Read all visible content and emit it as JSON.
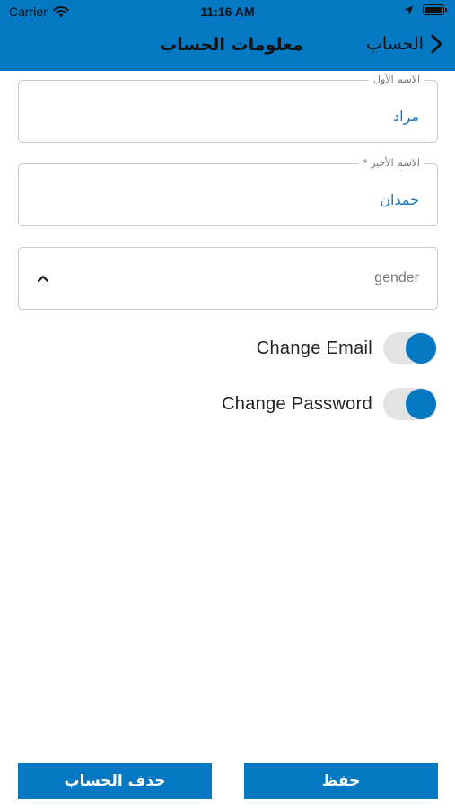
{
  "status_bar": {
    "carrier": "Carrier",
    "time": "11:16 AM",
    "wifi_icon": "wifi-icon",
    "location_icon": "location-arrow-icon",
    "battery_icon": "battery-full-icon"
  },
  "nav": {
    "title": "معلومات الحساب",
    "back_label": "الحساب",
    "back_icon": "chevron-right-icon"
  },
  "form": {
    "first_name": {
      "label": "الاسم الأول",
      "value": "مراد"
    },
    "last_name": {
      "label": "الاسم الأخير *",
      "value": "حمدان"
    },
    "gender": {
      "placeholder": "gender",
      "icon": "chevron-up-icon"
    }
  },
  "toggles": [
    {
      "label": "Change Email",
      "on": true
    },
    {
      "label": "Change Password",
      "on": true
    }
  ],
  "buttons": {
    "delete_account": "حذف الحساب",
    "save": "حفظ"
  },
  "colors": {
    "accent": "#0578c3",
    "value_text": "#1275c4",
    "border": "#c9c9c9"
  }
}
